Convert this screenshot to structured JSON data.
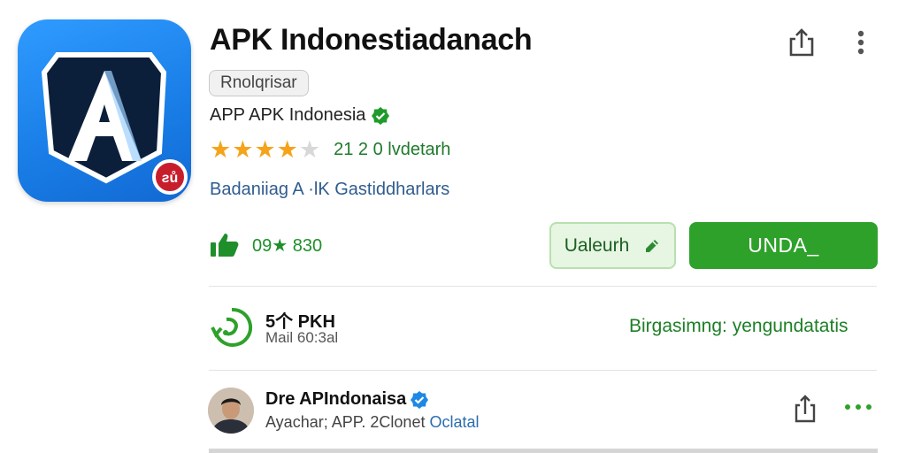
{
  "app": {
    "title": "APK Indonestiadanach",
    "tag": "Rnolqrisar",
    "developer": "APP APK Indonesia",
    "rating": 4,
    "rating_max": 5,
    "rating_text": "21 2 0  lvdetarh",
    "category_line": "Badaniiag  A  ·lK  Gastiddharlars",
    "likes_text": "09★ 830"
  },
  "actions": {
    "secondary_label": "Ualeurh",
    "primary_label": "UNDA_"
  },
  "update": {
    "title": "5个 PKH",
    "subtitle": "Mail 60:3al",
    "status": "Birgasimng: yengundatatis"
  },
  "publisher": {
    "name": "Dre APIndonaisa",
    "subtitle_prefix": "Ayachar; APP. 2Clonet ",
    "subtitle_link": "Oclatal"
  },
  "icons": {
    "app_icon": "a-logo-icon",
    "share": "share-icon",
    "more": "more-vert-icon",
    "verified": "verified-badge-icon",
    "thumb": "thumb-up-icon",
    "update": "refresh-icon",
    "edit": "edit-icon"
  },
  "colors": {
    "accent_green": "#2ea12b",
    "star": "#f5a31a",
    "icon_blue": "#1a7fe8",
    "link_blue": "#2b6cb0"
  }
}
